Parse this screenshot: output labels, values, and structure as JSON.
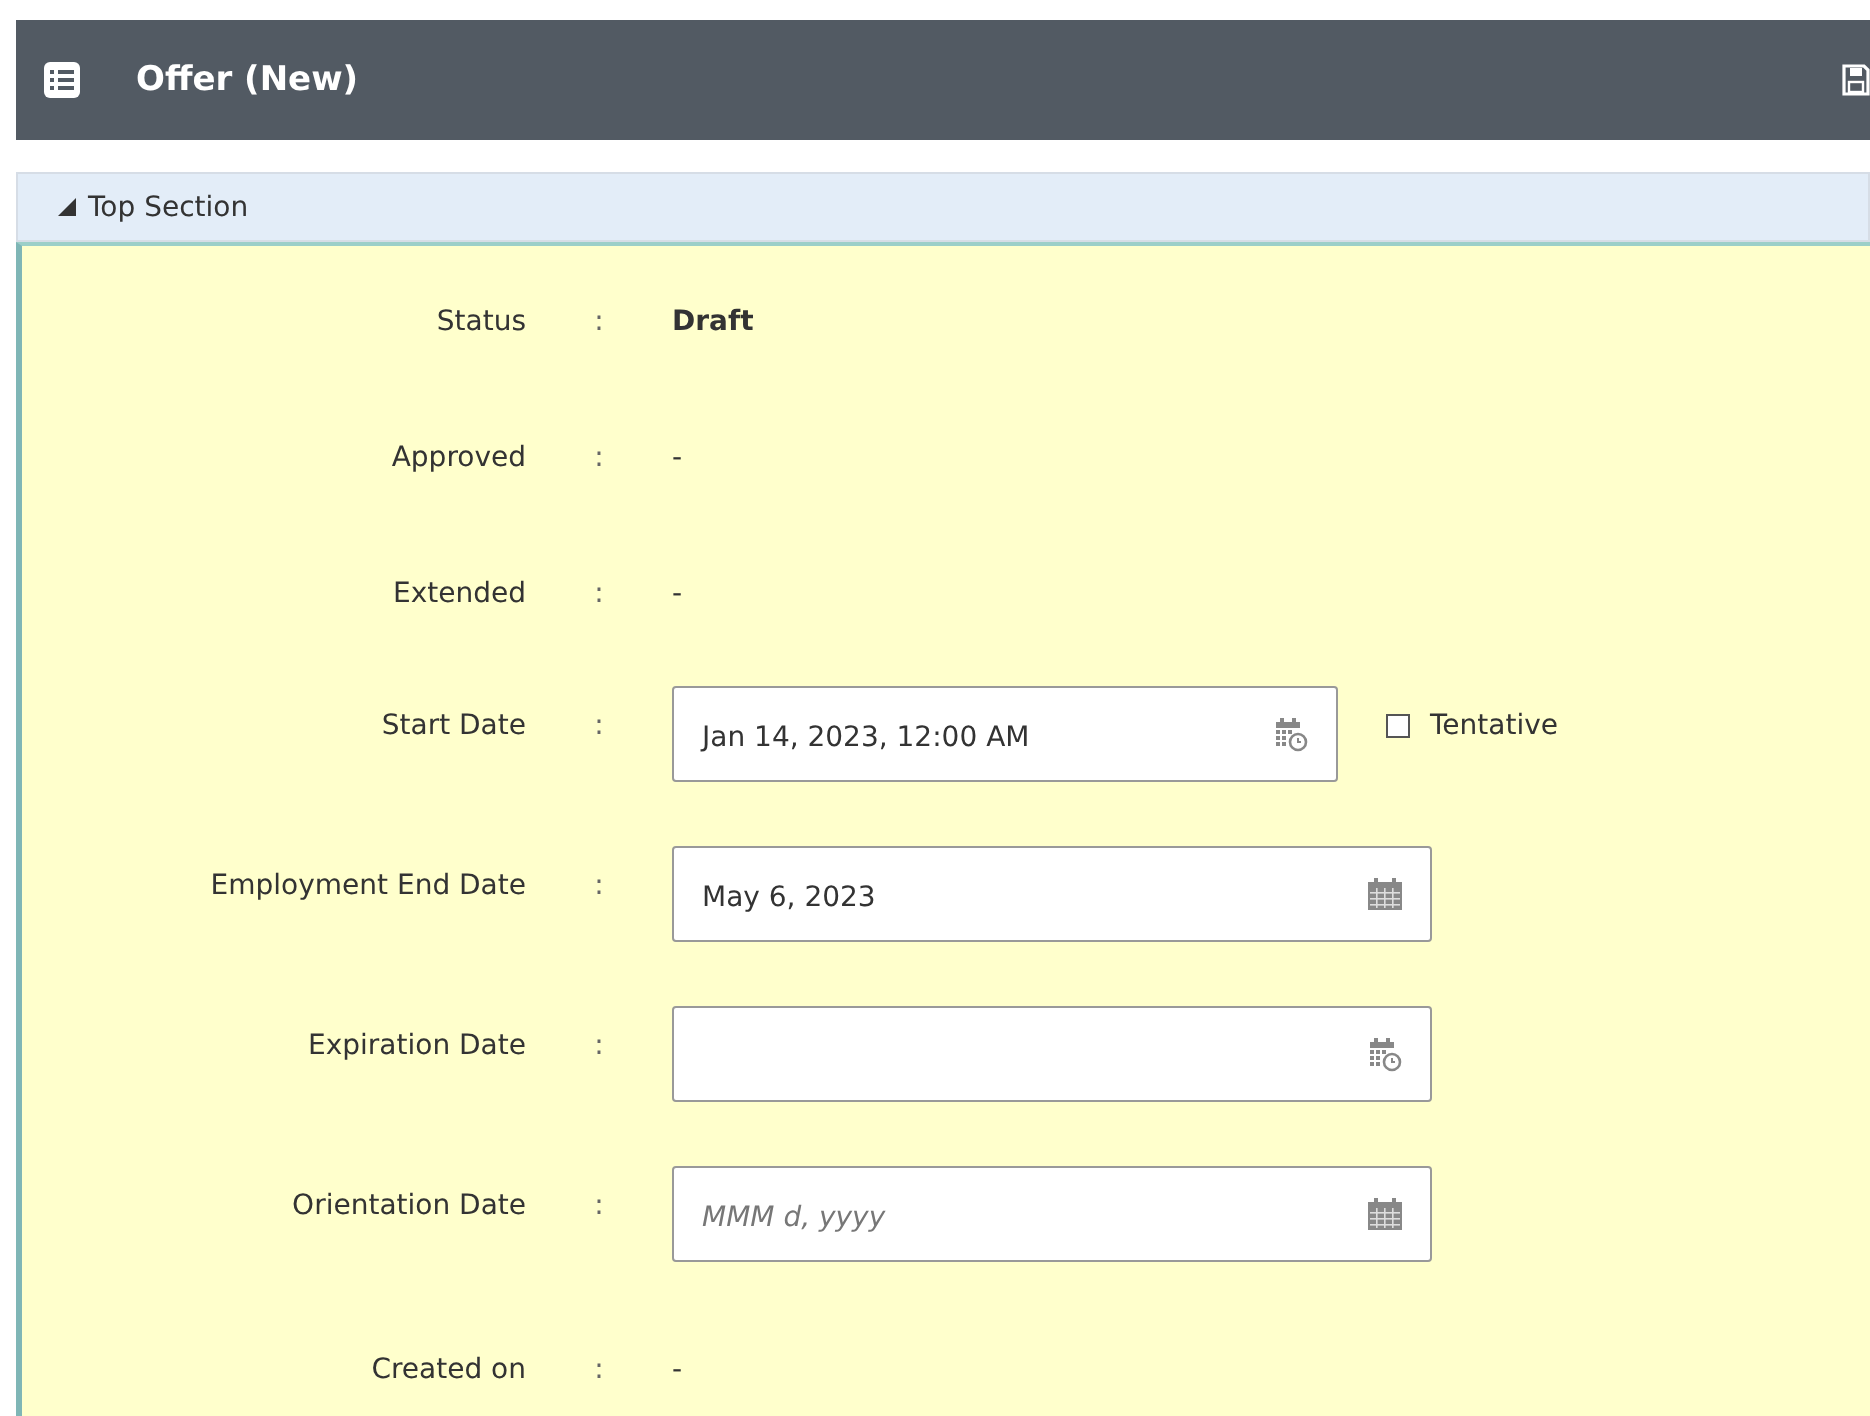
{
  "header": {
    "title": "Offer (New)"
  },
  "section": {
    "title": "Top Section",
    "expanded": true
  },
  "rows": [
    {
      "kind": "text",
      "label": "Status",
      "separator": ":",
      "value": "Draft",
      "bold": true
    },
    {
      "kind": "text",
      "label": "Approved",
      "separator": ":",
      "value": "-",
      "bold": false
    },
    {
      "kind": "text",
      "label": "Extended",
      "separator": ":",
      "value": "-",
      "bold": false
    },
    {
      "kind": "field",
      "label": "Start Date",
      "separator": ":",
      "input": {
        "kind": "datetime",
        "value": "Jan 14, 2023, 12:00 AM"
      },
      "checkbox": {
        "label": "Tentative",
        "checked": false
      }
    },
    {
      "kind": "field",
      "label": "Employment End Date",
      "separator": ":",
      "input": {
        "kind": "date",
        "value": "May 6, 2023"
      }
    },
    {
      "kind": "field",
      "label": "Expiration Date",
      "separator": ":",
      "input": {
        "kind": "datetime"
      }
    },
    {
      "kind": "field",
      "label": "Orientation Date",
      "separator": ":",
      "input": {
        "kind": "date",
        "placeholder": "MMM d, yyyy"
      }
    },
    {
      "kind": "text",
      "label": "Created on",
      "separator": ":",
      "value": "-",
      "bold": false
    }
  ]
}
